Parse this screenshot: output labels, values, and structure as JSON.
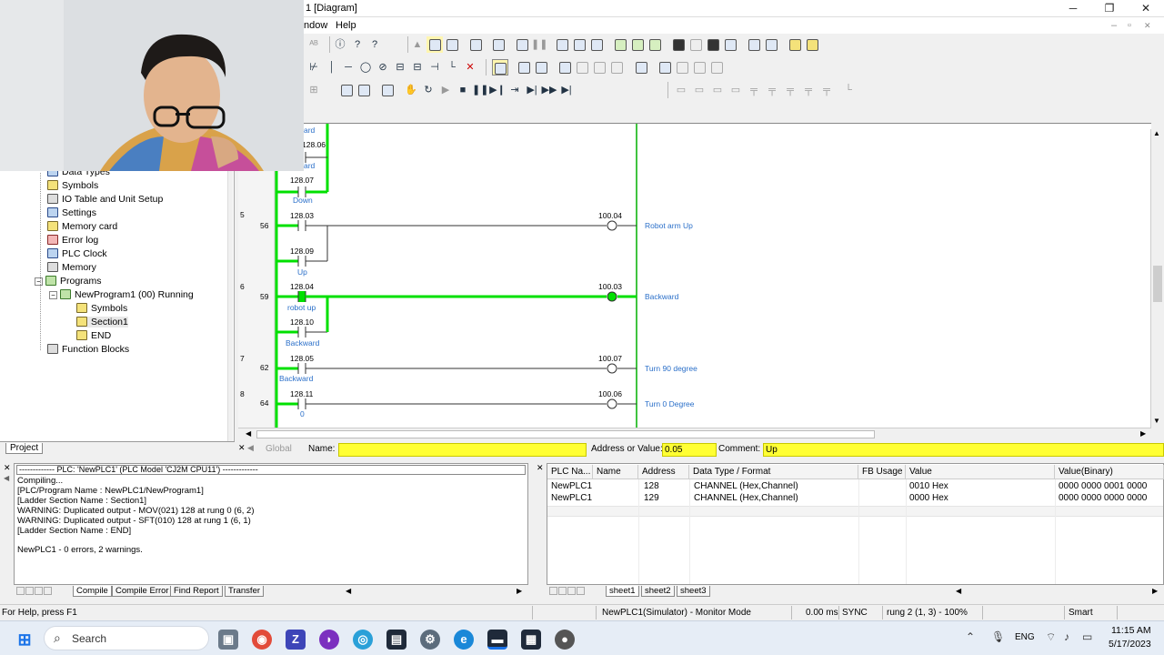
{
  "window": {
    "title": "1 [Diagram]",
    "minimize": "─",
    "maximize": "❐",
    "close": "✕"
  },
  "menu": {
    "window": "ndow",
    "help": "Help"
  },
  "mdi": {
    "minimize": "‒",
    "restore": "▫",
    "close": "✕"
  },
  "project_tree": {
    "items": [
      {
        "label": "Data Types",
        "icon": "datatypes-icon"
      },
      {
        "label": "Symbols",
        "icon": "symbols-icon"
      },
      {
        "label": "IO Table and Unit Setup",
        "icon": "io-table-icon"
      },
      {
        "label": "Settings",
        "icon": "settings-icon"
      },
      {
        "label": "Memory card",
        "icon": "memory-card-icon"
      },
      {
        "label": "Error log",
        "icon": "error-log-icon"
      },
      {
        "label": "PLC Clock",
        "icon": "plc-clock-icon"
      },
      {
        "label": "Memory",
        "icon": "memory-icon"
      },
      {
        "label": "Programs",
        "icon": "programs-icon"
      },
      {
        "label": "NewProgram1 (00) Running",
        "icon": "program-icon"
      },
      {
        "label": "Symbols",
        "icon": "symbols-icon"
      },
      {
        "label": "Section1",
        "icon": "section-icon"
      },
      {
        "label": "END",
        "icon": "end-icon"
      },
      {
        "label": "Function Blocks",
        "icon": "function-blocks-icon"
      }
    ],
    "tab": "Project"
  },
  "ladder": {
    "top_labels": [
      "ard",
      "128.06",
      "ard",
      "128.07",
      "Down"
    ],
    "rungs": [
      {
        "rung": "5",
        "step": "56",
        "contact1": "128.03",
        "contact2": "128.09",
        "contact2_comment": "Up",
        "coil": "100.04",
        "coil_comment": "Robot arm Up",
        "active": false
      },
      {
        "rung": "6",
        "step": "59",
        "contact1": "128.04",
        "contact1_comment": "robot up",
        "contact2": "128.10",
        "contact2_comment": "Backward",
        "coil": "100.03",
        "coil_comment": "Backward",
        "active": true
      },
      {
        "rung": "7",
        "step": "62",
        "contact1": "128.05",
        "contact1_comment": "Backward",
        "coil": "100.07",
        "coil_comment": "Turn 90 degree",
        "active": false
      },
      {
        "rung": "8",
        "step": "64",
        "contact1": "128.11",
        "contact1_comment": "0",
        "coil": "100.06",
        "coil_comment": "Turn 0 Degree",
        "active": false
      }
    ]
  },
  "name_bar": {
    "global_label": "Global",
    "name_label": "Name:",
    "name_value": "",
    "address_label": "Address or Value:",
    "address_value": "0.05",
    "comment_label": "Comment:",
    "comment_value": "Up"
  },
  "output": {
    "header": "------------- PLC: 'NewPLC1' (PLC Model 'CJ2M CPU11') -------------",
    "lines": [
      "Compiling...",
      "[PLC/Program Name : NewPLC1/NewProgram1]",
      "[Ladder Section Name : Section1]",
      "WARNING: Duplicated output -  MOV(021) 128 at rung 0 (6, 2)",
      "WARNING: Duplicated output -  SFT(010) 128 at rung 1 (6, 1)",
      "[Ladder Section Name : END]",
      "",
      "NewPLC1 - 0 errors, 2 warnings."
    ],
    "tabs": [
      "Compile",
      "Compile Error",
      "Find Report",
      "Transfer"
    ]
  },
  "watch": {
    "columns": [
      "PLC Na...",
      "Name",
      "Address",
      "Data Type / Format",
      "FB Usage",
      "Value",
      "Value(Binary)"
    ],
    "rows": [
      [
        "NewPLC1",
        "",
        "128",
        "CHANNEL (Hex,Channel)",
        "",
        "0010 Hex",
        "0000 0000 0001 0000"
      ],
      [
        "NewPLC1",
        "",
        "129",
        "CHANNEL (Hex,Channel)",
        "",
        "0000 Hex",
        "0000 0000 0000 0000"
      ]
    ],
    "tabs": [
      "sheet1",
      "sheet2",
      "sheet3"
    ]
  },
  "status": {
    "help": "For Help, press F1",
    "mode": "NewPLC1(Simulator) - Monitor Mode",
    "cycle": "0.00 ms",
    "sync": "SYNC",
    "position": "rung 2 (1, 3)  - 100%",
    "smart": "Smart"
  },
  "taskbar": {
    "search_placeholder": "Search",
    "lang": "ENG",
    "time": "11:15 AM",
    "date": "5/17/2023"
  },
  "colors": {
    "active_rung": "#00e000",
    "comment_blue": "#2a6fc9",
    "highlight_yellow": "#ffff33"
  }
}
